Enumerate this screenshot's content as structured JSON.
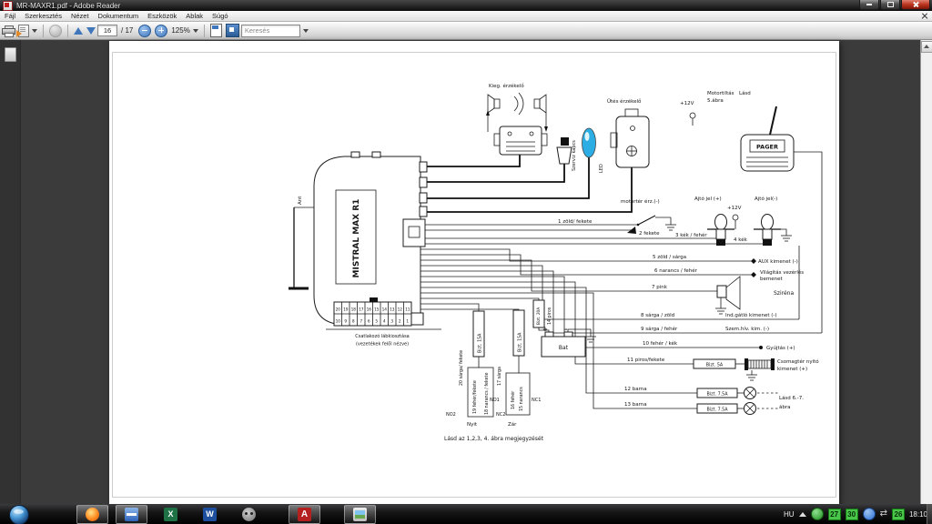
{
  "window": {
    "title": "MR-MAXR1.pdf - Adobe Reader"
  },
  "menu": {
    "items": [
      "Fájl",
      "Szerkesztés",
      "Nézet",
      "Dokumentum",
      "Eszközök",
      "Ablak",
      "Súgó"
    ]
  },
  "toolbar": {
    "page_current": "16",
    "page_separator": "/ 17",
    "zoom_level": "125%",
    "search_placeholder": "Keresés"
  },
  "taskbar_icons": {
    "excel_letter": "X",
    "word_letter": "W",
    "adobe_letter": "A",
    "sync_glyph": "⇄"
  },
  "tray": {
    "language": "HU",
    "badge1": "27",
    "badge2": "30",
    "badge3": "26",
    "clock": "18:10"
  },
  "diagram": {
    "unit": "MISTRAL MAX R1",
    "ant": "Ant",
    "pins_top": [
      "20",
      "19",
      "18",
      "17",
      "16",
      "15",
      "14",
      "13",
      "12",
      "11"
    ],
    "pins_bottom": [
      "10",
      "9",
      "8",
      "7",
      "6",
      "5",
      "4",
      "3",
      "2",
      "1"
    ],
    "connector_caption_1": "Csatlakozó lábkiosztása",
    "connector_caption_2": "(vezetékek felől nézve)",
    "kieg": "Kieg. érzékelő",
    "utes": "Ütés érzékelő",
    "szerviz": "Szerviz kapcs",
    "led": "LED",
    "v12_top": "+12V",
    "motortiltas_a": "Motortiltás",
    "motortiltas_lasd": "Lásd",
    "motortiltas_b": "5.ábra",
    "pager": "PAGER",
    "motorter": "motortér érz.(-)",
    "ajto_p": "Ajtó jel (+)",
    "ajto_n": "Ajtó jel(-)",
    "v12_door": "+12V",
    "w1": "1 zöld/ fekete",
    "w2": "2 fekete",
    "w3": "3 kék / fehér",
    "w4": "4 kék",
    "w5": "5 zöld / sárga",
    "w6": "6 narancs / fehér",
    "w7": "7 pink",
    "w8": "8 sárga / zöld",
    "w9": "9 sárga / fehér",
    "w10": "10 fehér / kék",
    "w11": "11 piros/fekete",
    "w12": "12 barna",
    "w13": "13 barna",
    "aux": "AUX kimenet (-)",
    "vilagitas1": "Világítás vezérlés",
    "vilagitas2": "bemenet",
    "szirena": "Sziréna",
    "indgatlo": "Ind.gátló kimenet (-)",
    "szemhiv": "Szem.hív. kim. (-)",
    "gyujtas": "Gyújtás (+)",
    "fuse5": "Bizt. 5A",
    "fuse75": "Bizt. 7.5A",
    "fuse15": "Bizt. 15A",
    "fuse20": "Bizt. 20A",
    "csomagter1": "Csomagtér nyitó",
    "csomagter2": "kimenet (+)",
    "lasd67a": "Lásd 6.-7.",
    "lasd67b": "ábra",
    "w14": "14 piros",
    "w15": "15 narancs",
    "w16": "16 fehér",
    "w17": "17 sárga",
    "w18": "18 narancs / fekete",
    "w19": "19 fehér/fekete",
    "w20": "20 sárga/ fekete",
    "no1": "NO1",
    "nc1": "NC1",
    "no2": "NO2",
    "nc2": "NC2",
    "nyit": "Nyit",
    "zar": "Zár",
    "bat": "Bat",
    "plus": "+",
    "minus": "–",
    "note": "Lásd az 1,2,3, 4. ábra megjegyzését"
  }
}
